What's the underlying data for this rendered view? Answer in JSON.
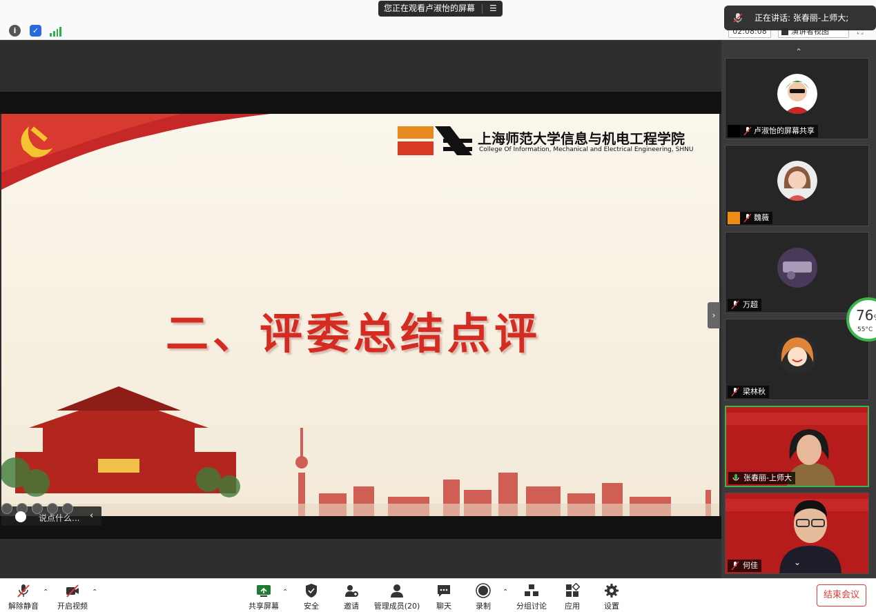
{
  "top": {
    "share_notice": "您正在观看卢淑怡的屏幕",
    "timer": "02:08:08",
    "view_mode": "演讲者视图",
    "speaking_banner": "正在讲话: 张春丽-上师大;"
  },
  "slide": {
    "school_name": "上海师范大学信息与机电工程学院",
    "school_name_en": "College Of Information, Mechanical and Electrical Engineering, SHNU",
    "title": "二、评委总结点评",
    "comment_placeholder": "说点什么..."
  },
  "participants": [
    {
      "name": "卢淑怡的屏幕共享",
      "type": "share"
    },
    {
      "name": "魏薇",
      "type": "avatar"
    },
    {
      "name": "万超",
      "type": "avatar"
    },
    {
      "name": "梁林秋",
      "type": "avatar"
    },
    {
      "name": "张春丽-上师大",
      "type": "video",
      "speaking": true
    },
    {
      "name": "何佳",
      "type": "video"
    }
  ],
  "cpu": {
    "value": "76",
    "unit": "%",
    "temp": "55°C"
  },
  "toolbar": {
    "unmute": "解除静音",
    "start_video": "开启视频",
    "share_screen": "共享屏幕",
    "security": "安全",
    "invite": "邀请",
    "participants": "管理成员(20)",
    "chat": "聊天",
    "record": "录制",
    "breakout": "分组讨论",
    "apps": "应用",
    "settings": "设置",
    "end_meeting": "结束会议"
  },
  "colors": {
    "accent_red": "#e53935",
    "active_green": "#3bb54a",
    "slide_red": "#d42b22"
  }
}
